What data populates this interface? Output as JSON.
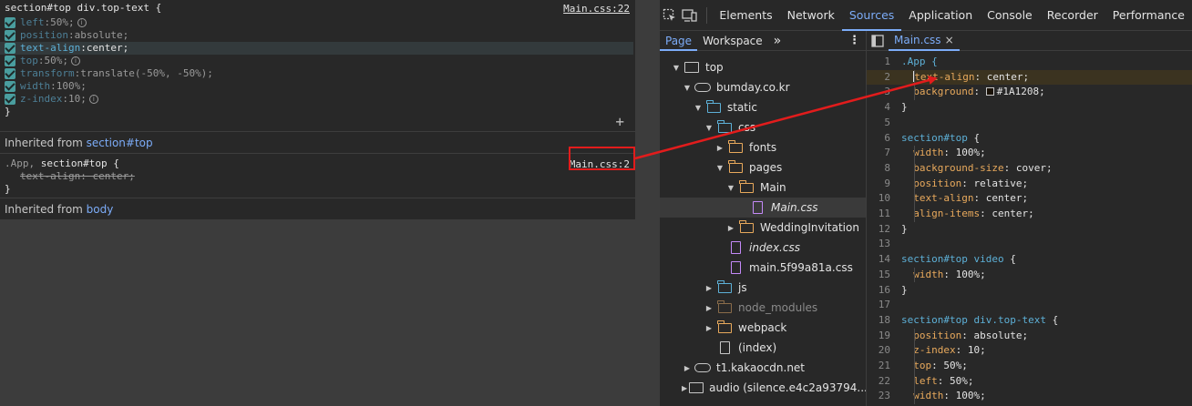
{
  "styles": {
    "rule1": {
      "selector": "section#top div.top-text {",
      "source": "Main.css:22",
      "decls": [
        {
          "name": "left",
          "value": "50%;",
          "info": true
        },
        {
          "name": "position",
          "value": "absolute;",
          "info": false
        },
        {
          "name": "text-align",
          "value": "center;",
          "info": false
        },
        {
          "name": "top",
          "value": "50%;",
          "info": true
        },
        {
          "name": "transform",
          "value": "translate(-50%, -50%);",
          "info": false
        },
        {
          "name": "width",
          "value": "100%;",
          "info": false
        },
        {
          "name": "z-index",
          "value": "10;",
          "info": true
        }
      ],
      "close": "}"
    },
    "inherited1": {
      "label": "Inherited from ",
      "link": "section#top"
    },
    "rule2": {
      "selector_dim": ".App, ",
      "selector": "section#top {",
      "source": "Main.css:2",
      "decl": "text-align: center;",
      "close": "}"
    },
    "inherited2": {
      "label": "Inherited from ",
      "link": "body"
    }
  },
  "devtools": {
    "tabs": [
      "Elements",
      "Network",
      "Sources",
      "Application",
      "Console",
      "Recorder",
      "Performance"
    ],
    "active_tab": "Sources",
    "nav_tabs": [
      "Page",
      "Workspace"
    ],
    "more": "»",
    "file_tab": "Main.css",
    "file_close": "×",
    "tree": [
      {
        "label": "top",
        "depth": 0,
        "arrow": "down",
        "icon": "frame"
      },
      {
        "label": "bumday.co.kr",
        "depth": 1,
        "arrow": "down",
        "icon": "cloud"
      },
      {
        "label": "static",
        "depth": 2,
        "arrow": "down",
        "icon": "folder-blue"
      },
      {
        "label": "css",
        "depth": 3,
        "arrow": "down",
        "icon": "folder-blue"
      },
      {
        "label": "fonts",
        "depth": 4,
        "arrow": "right",
        "icon": "folder"
      },
      {
        "label": "pages",
        "depth": 4,
        "arrow": "down",
        "icon": "folder"
      },
      {
        "label": "Main",
        "depth": 5,
        "arrow": "down",
        "icon": "folder"
      },
      {
        "label": "Main.css",
        "depth": 6,
        "arrow": "",
        "icon": "file-css",
        "italic": true,
        "selected": true
      },
      {
        "label": "WeddingInvitation",
        "depth": 5,
        "arrow": "right",
        "icon": "folder"
      },
      {
        "label": "index.css",
        "depth": 4,
        "arrow": "",
        "icon": "file-css",
        "italic": true
      },
      {
        "label": "main.5f99a81a.css",
        "depth": 4,
        "arrow": "",
        "icon": "file-css"
      },
      {
        "label": "js",
        "depth": 3,
        "arrow": "right",
        "icon": "folder-blue"
      },
      {
        "label": "node_modules",
        "depth": 3,
        "arrow": "right",
        "icon": "folder-dim",
        "muted": true
      },
      {
        "label": "webpack",
        "depth": 3,
        "arrow": "right",
        "icon": "folder"
      },
      {
        "label": "(index)",
        "depth": 3,
        "arrow": "",
        "icon": "file"
      },
      {
        "label": "t1.kakaocdn.net",
        "depth": 1,
        "arrow": "right",
        "icon": "cloud"
      },
      {
        "label": "audio (silence.e4c2a93794...",
        "depth": 1,
        "arrow": "right",
        "icon": "frame"
      }
    ],
    "code": [
      {
        "n": "1",
        "parts": [
          [
            "sel",
            ".App {"
          ]
        ]
      },
      {
        "n": "2",
        "parts": [
          [
            "cursor",
            ""
          ],
          [
            "prop",
            "text-align"
          ],
          [
            "txt",
            ": center;"
          ]
        ],
        "hl": true,
        "indent": 1
      },
      {
        "n": "3",
        "parts": [
          [
            "prop",
            "background"
          ],
          [
            "txt",
            ": "
          ],
          [
            "swatch",
            ""
          ],
          [
            "txt",
            "#1A1208;"
          ]
        ],
        "indent": 1
      },
      {
        "n": "4",
        "parts": [
          [
            "txt",
            "}"
          ]
        ]
      },
      {
        "n": "5",
        "parts": []
      },
      {
        "n": "6",
        "parts": [
          [
            "sel",
            "section#top"
          ],
          [
            "txt",
            " {"
          ]
        ]
      },
      {
        "n": "7",
        "parts": [
          [
            "prop",
            "width"
          ],
          [
            "txt",
            ": 100%;"
          ]
        ],
        "indent": 1
      },
      {
        "n": "8",
        "parts": [
          [
            "prop",
            "background-size"
          ],
          [
            "txt",
            ": cover;"
          ]
        ],
        "indent": 1
      },
      {
        "n": "9",
        "parts": [
          [
            "prop",
            "position"
          ],
          [
            "txt",
            ": relative;"
          ]
        ],
        "indent": 1
      },
      {
        "n": "10",
        "parts": [
          [
            "prop",
            "text-align"
          ],
          [
            "txt",
            ": center;"
          ]
        ],
        "indent": 1
      },
      {
        "n": "11",
        "parts": [
          [
            "prop",
            "align-items"
          ],
          [
            "txt",
            ": center;"
          ]
        ],
        "indent": 1
      },
      {
        "n": "12",
        "parts": [
          [
            "txt",
            "}"
          ]
        ]
      },
      {
        "n": "13",
        "parts": []
      },
      {
        "n": "14",
        "parts": [
          [
            "sel",
            "section#top video"
          ],
          [
            "txt",
            " {"
          ]
        ]
      },
      {
        "n": "15",
        "parts": [
          [
            "prop",
            "width"
          ],
          [
            "txt",
            ": 100%;"
          ]
        ],
        "indent": 1
      },
      {
        "n": "16",
        "parts": [
          [
            "txt",
            "}"
          ]
        ]
      },
      {
        "n": "17",
        "parts": []
      },
      {
        "n": "18",
        "parts": [
          [
            "sel",
            "section#top div.top-text"
          ],
          [
            "txt",
            " {"
          ]
        ]
      },
      {
        "n": "19",
        "parts": [
          [
            "prop",
            "position"
          ],
          [
            "txt",
            ": absolute;"
          ]
        ],
        "indent": 1
      },
      {
        "n": "20",
        "parts": [
          [
            "prop",
            "z-index"
          ],
          [
            "txt",
            ": 10;"
          ]
        ],
        "indent": 1
      },
      {
        "n": "21",
        "parts": [
          [
            "prop",
            "top"
          ],
          [
            "txt",
            ": 50%;"
          ]
        ],
        "indent": 1
      },
      {
        "n": "22",
        "parts": [
          [
            "prop",
            "left"
          ],
          [
            "txt",
            ": 50%;"
          ]
        ],
        "indent": 1
      },
      {
        "n": "23",
        "parts": [
          [
            "prop",
            "width"
          ],
          [
            "txt",
            ": 100%;"
          ]
        ],
        "indent": 1
      }
    ]
  },
  "colors": {
    "accent": "#7cacf8",
    "highlight": "#e21c1c",
    "swatch": "#1A1208"
  }
}
